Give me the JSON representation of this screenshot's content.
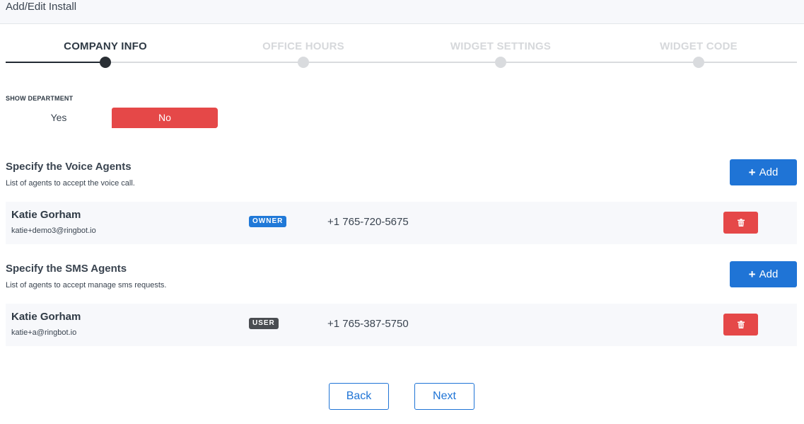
{
  "header": {
    "title": "Add/Edit Install"
  },
  "stepper": {
    "steps": [
      {
        "label": "COMPANY INFO"
      },
      {
        "label": "OFFICE HOURS"
      },
      {
        "label": "WIDGET SETTINGS"
      },
      {
        "label": "WIDGET CODE"
      }
    ],
    "active_index": 0
  },
  "show_department": {
    "label": "SHOW DEPARTMENT",
    "yes_label": "Yes",
    "no_label": "No",
    "selected": "No"
  },
  "voice_agents": {
    "title": "Specify the Voice Agents",
    "subtitle": "List of agents to accept the voice call.",
    "add_label": "Add",
    "agents": [
      {
        "name": "Katie Gorham",
        "email": "katie+demo3@ringbot.io",
        "role": "OWNER",
        "phone": "+1 765-720-5675"
      }
    ]
  },
  "sms_agents": {
    "title": "Specify the SMS Agents",
    "subtitle": "List of agents to accept manage sms requests.",
    "add_label": "Add",
    "agents": [
      {
        "name": "Katie Gorham",
        "email": "katie+a@ringbot.io",
        "role": "USER",
        "phone": "+1 765-387-5750"
      }
    ]
  },
  "footer": {
    "back_label": "Back",
    "next_label": "Next"
  },
  "colors": {
    "primary": "#1f74d6",
    "danger": "#e54848",
    "owner_badge": "#2079d8",
    "user_badge": "#4a4d51"
  },
  "icons": {
    "add": "plus-icon",
    "delete": "trash-icon"
  }
}
